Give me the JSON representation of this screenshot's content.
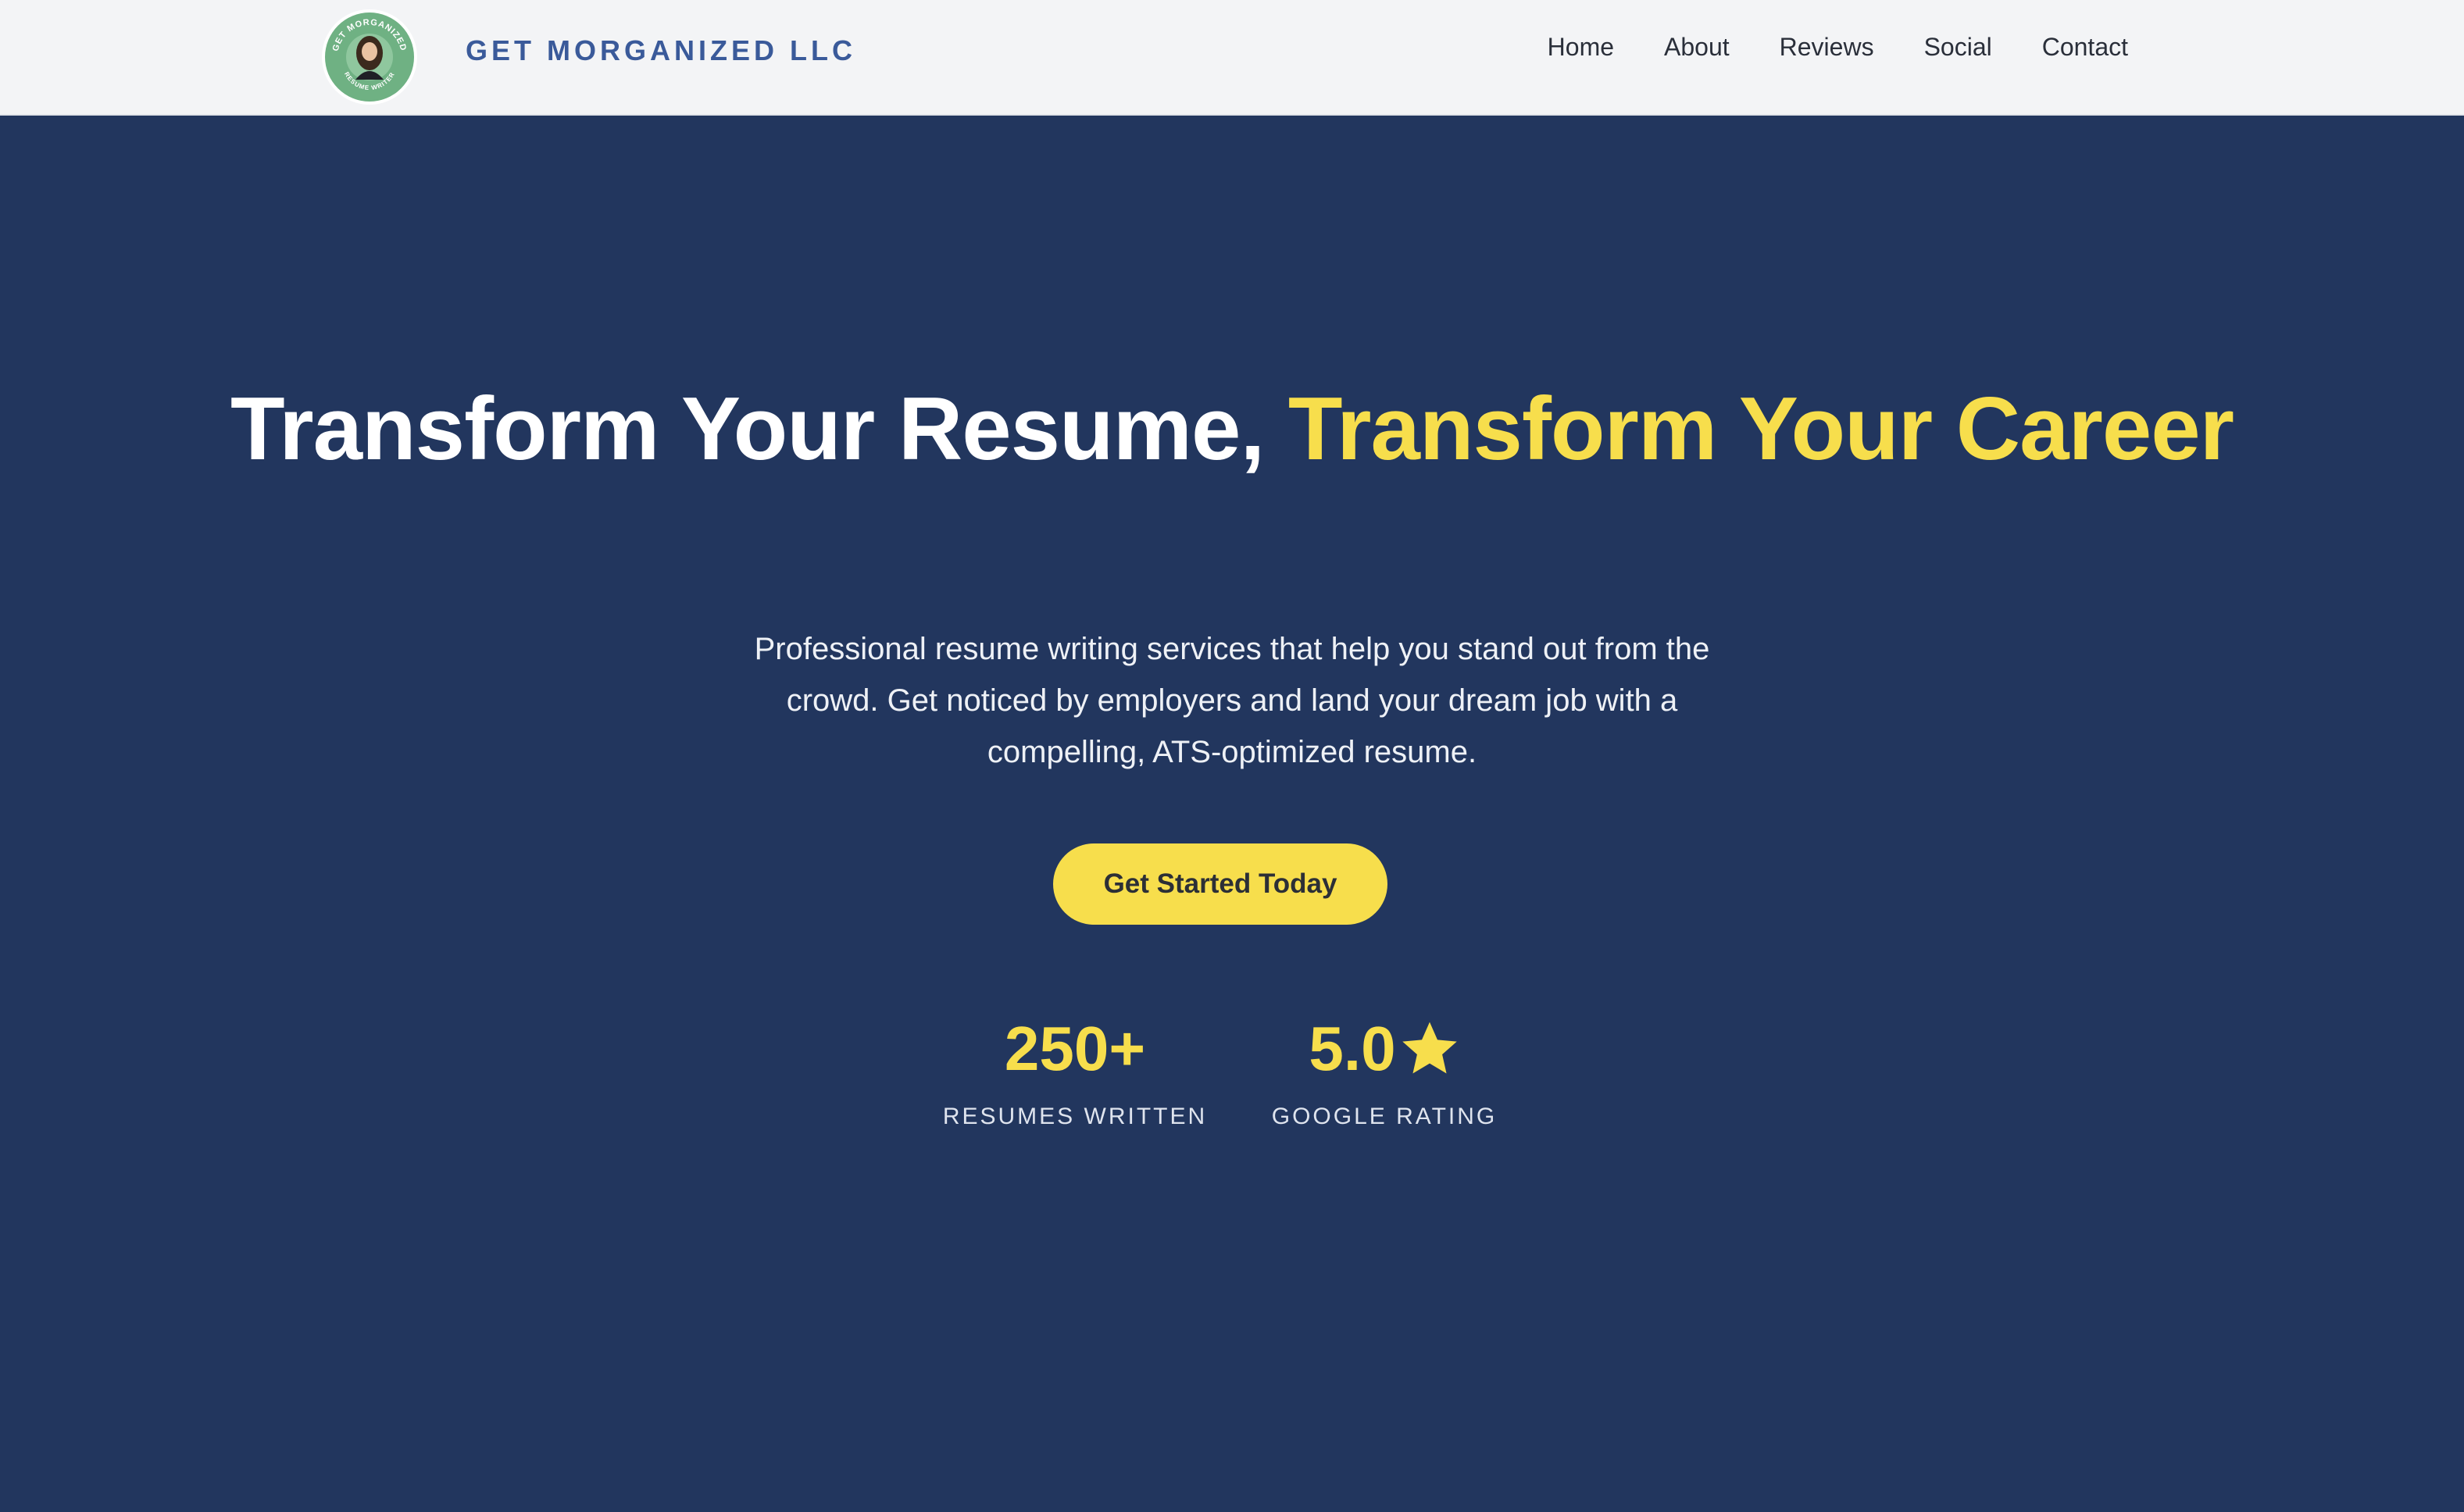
{
  "header": {
    "logo_text": {
      "top": "GET MORGANIZED",
      "bottom": "RESUME WRITER"
    },
    "brand": "GET MORGANIZED LLC",
    "nav": [
      {
        "label": "Home"
      },
      {
        "label": "About"
      },
      {
        "label": "Reviews"
      },
      {
        "label": "Social"
      },
      {
        "label": "Contact"
      }
    ]
  },
  "hero": {
    "headline_part1": "Transform Your Resume,",
    "headline_part2": "Transform Your Career",
    "subtitle": "Professional resume writing services that help you stand out from the crowd. Get noticed by employers and land your dream job with a compelling, ATS-optimized resume.",
    "cta_label": "Get Started Today",
    "stats": [
      {
        "value": "250+",
        "label": "RESUMES WRITTEN"
      },
      {
        "value": "5.0",
        "icon": "star-icon",
        "label": "GOOGLE RATING"
      }
    ]
  },
  "colors": {
    "hero_bg": "#22365e",
    "accent": "#f7de4c",
    "brand": "#3a5a9a",
    "nav_bg": "#f3f4f6"
  }
}
